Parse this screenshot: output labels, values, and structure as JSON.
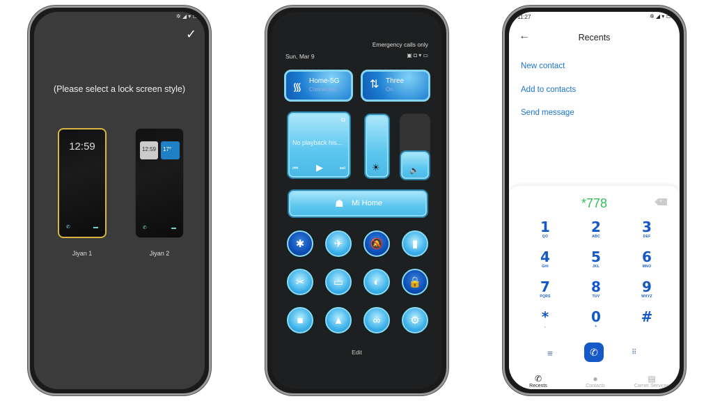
{
  "phone1": {
    "title": "(Please select a lock screen style)",
    "confirm_icon": "checkmark-icon",
    "styles": [
      {
        "label": "Jiyan 1",
        "time": "12:59",
        "selected": true
      },
      {
        "label": "Jiyan 2",
        "time": "12:59",
        "temp": "17°",
        "selected": false
      }
    ],
    "selected_border_color": "#d8b640"
  },
  "phone2": {
    "emergency": "Emergency calls only",
    "date": "Sun, Mar 9",
    "wifi": {
      "name": "Home-5G",
      "status": "Connected"
    },
    "mobile": {
      "name": "Three",
      "status": "On"
    },
    "media": "No playback his...",
    "brightness_level": 1.0,
    "volume_level": 0.45,
    "mi_home": "Mi Home",
    "toggles": [
      {
        "icon": "bluetooth-icon",
        "glyph": "✱",
        "on": true
      },
      {
        "icon": "airplane-icon",
        "glyph": "✈",
        "on": false
      },
      {
        "icon": "mute-icon",
        "glyph": "🔕",
        "on": true
      },
      {
        "icon": "flashlight-icon",
        "glyph": "▮",
        "on": false
      },
      {
        "icon": "screenshot-icon",
        "glyph": "✂",
        "on": false
      },
      {
        "icon": "battery-saver-icon",
        "glyph": "▭",
        "on": false
      },
      {
        "icon": "dark-mode-icon",
        "glyph": "◐",
        "on": false
      },
      {
        "icon": "rotation-lock-icon",
        "glyph": "🔒",
        "on": true
      },
      {
        "icon": "screen-record-icon",
        "glyph": "■",
        "on": false
      },
      {
        "icon": "cast-icon",
        "glyph": "▲",
        "on": false
      },
      {
        "icon": "link-icon",
        "glyph": "∞",
        "on": false
      },
      {
        "icon": "settings-icon",
        "glyph": "⚙",
        "on": false
      }
    ],
    "edit": "Edit"
  },
  "phone3": {
    "time": "11:27",
    "title": "Recents",
    "menu": [
      "New contact",
      "Add to contacts",
      "Send message"
    ],
    "number": "*778",
    "number_color": "#2fbf5a",
    "keys": [
      {
        "d": "1",
        "l": "QO"
      },
      {
        "d": "2",
        "l": "ABC"
      },
      {
        "d": "3",
        "l": "DEF"
      },
      {
        "d": "4",
        "l": "GHI"
      },
      {
        "d": "5",
        "l": "JKL"
      },
      {
        "d": "6",
        "l": "MNO"
      },
      {
        "d": "7",
        "l": "PQRS"
      },
      {
        "d": "8",
        "l": "TUV"
      },
      {
        "d": "9",
        "l": "WXYZ"
      },
      {
        "d": "*",
        "l": ","
      },
      {
        "d": "0",
        "l": "+"
      },
      {
        "d": "#",
        "l": ""
      }
    ],
    "nav": [
      "Recents",
      "Contacts",
      "Carrier Services"
    ],
    "accent": "#1558c8"
  }
}
